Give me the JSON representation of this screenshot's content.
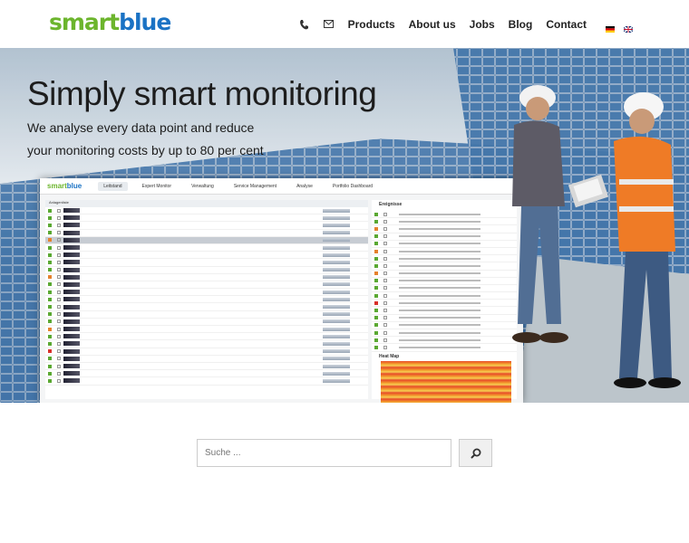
{
  "brand": {
    "logo_part1": "smart",
    "logo_part2": "blue",
    "color_green": "#6cb52d",
    "color_blue": "#1a72c4"
  },
  "nav": {
    "phone_icon": "phone-icon",
    "mail_icon": "mail-icon",
    "items": [
      "Products",
      "About us",
      "Jobs",
      "Blog",
      "Contact"
    ],
    "flags": [
      "de-flag-icon",
      "uk-flag-icon"
    ]
  },
  "hero": {
    "title": "Simply smart monitoring",
    "subtitle_line1": "We analyse every data point and reduce",
    "subtitle_line2": "your monitoring costs by up to 80 per cent"
  },
  "dashboard": {
    "logo_part1": "smart",
    "logo_part2": "blue",
    "tabs": [
      "Leitstand",
      "Expert Monitor",
      "Verwaltung",
      "Service Management",
      "Analyse",
      "Portfolio Dashboard"
    ],
    "left_panel_label": "Anlagenliste",
    "right_panel_label": "Ereignisse",
    "heatmap_label": "Heat Map"
  },
  "search": {
    "placeholder": "Suche ...",
    "button_icon": "search-icon"
  }
}
